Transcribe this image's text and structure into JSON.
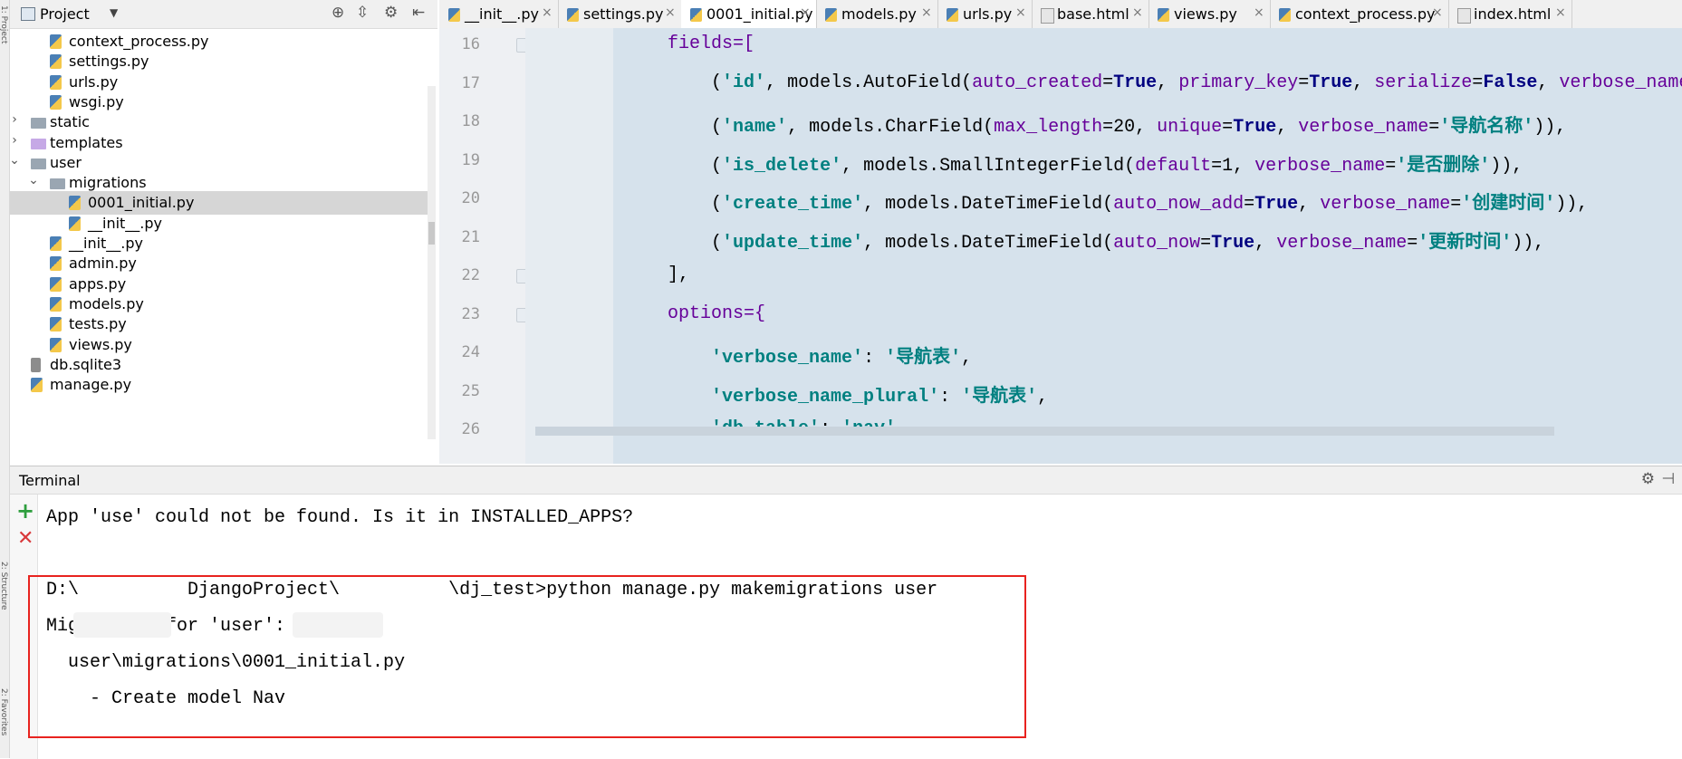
{
  "left_strip": {
    "labels": [
      "1: Project",
      "2: Structure",
      "2: Favorites"
    ]
  },
  "project": {
    "title": "Project",
    "items": [
      {
        "label": "context_process.py",
        "type": "py",
        "depth": 3
      },
      {
        "label": "settings.py",
        "type": "py",
        "depth": 3
      },
      {
        "label": "urls.py",
        "type": "py",
        "depth": 3
      },
      {
        "label": "wsgi.py",
        "type": "py",
        "depth": 3
      },
      {
        "label": "static",
        "type": "folder",
        "depth": 2,
        "arrow": "›"
      },
      {
        "label": "templates",
        "type": "folder-purple",
        "depth": 2,
        "arrow": "›"
      },
      {
        "label": "user",
        "type": "folder",
        "depth": 2,
        "arrow": "⌄"
      },
      {
        "label": "migrations",
        "type": "folder",
        "depth": 3,
        "arrow": "⌄"
      },
      {
        "label": "0001_initial.py",
        "type": "py",
        "depth": 4,
        "selected": true
      },
      {
        "label": "__init__.py",
        "type": "py",
        "depth": 4
      },
      {
        "label": "__init__.py",
        "type": "py",
        "depth": 3
      },
      {
        "label": "admin.py",
        "type": "py",
        "depth": 3
      },
      {
        "label": "apps.py",
        "type": "py",
        "depth": 3
      },
      {
        "label": "models.py",
        "type": "py",
        "depth": 3
      },
      {
        "label": "tests.py",
        "type": "py",
        "depth": 3
      },
      {
        "label": "views.py",
        "type": "py",
        "depth": 3
      },
      {
        "label": "db.sqlite3",
        "type": "db",
        "depth": 2
      },
      {
        "label": "manage.py",
        "type": "py",
        "depth": 2
      }
    ]
  },
  "tabs": [
    {
      "label": "__init__.py",
      "type": "py"
    },
    {
      "label": "settings.py",
      "type": "py"
    },
    {
      "label": "0001_initial.py",
      "type": "py",
      "active": true
    },
    {
      "label": "models.py",
      "type": "py"
    },
    {
      "label": "urls.py",
      "type": "py"
    },
    {
      "label": "base.html",
      "type": "html"
    },
    {
      "label": "views.py",
      "type": "py"
    },
    {
      "label": "context_process.py",
      "type": "py"
    },
    {
      "label": "index.html",
      "type": "html"
    }
  ],
  "tab_close_glyph": "×",
  "editor": {
    "line_numbers": [
      "16",
      "17",
      "18",
      "19",
      "20",
      "21",
      "22",
      "23",
      "24",
      "25",
      "26"
    ],
    "lines": [
      [
        {
          "t": "            fields=[",
          "c": "c-arg"
        }
      ],
      [
        {
          "t": "                (",
          "c": ""
        },
        {
          "t": "'id'",
          "c": "c-str"
        },
        {
          "t": ", models.AutoField(",
          "c": ""
        },
        {
          "t": "auto_created",
          "c": "c-arg"
        },
        {
          "t": "=",
          "c": ""
        },
        {
          "t": "True",
          "c": "c-kw"
        },
        {
          "t": ", ",
          "c": ""
        },
        {
          "t": "primary_key",
          "c": "c-arg"
        },
        {
          "t": "=",
          "c": ""
        },
        {
          "t": "True",
          "c": "c-kw"
        },
        {
          "t": ", ",
          "c": ""
        },
        {
          "t": "serialize",
          "c": "c-arg"
        },
        {
          "t": "=",
          "c": ""
        },
        {
          "t": "False",
          "c": "c-kw"
        },
        {
          "t": ", ",
          "c": ""
        },
        {
          "t": "verbose_name",
          "c": "c-arg"
        }
      ],
      [
        {
          "t": "                (",
          "c": ""
        },
        {
          "t": "'name'",
          "c": "c-str"
        },
        {
          "t": ", models.CharField(",
          "c": ""
        },
        {
          "t": "max_length",
          "c": "c-arg"
        },
        {
          "t": "=20, ",
          "c": ""
        },
        {
          "t": "unique",
          "c": "c-arg"
        },
        {
          "t": "=",
          "c": ""
        },
        {
          "t": "True",
          "c": "c-kw"
        },
        {
          "t": ", ",
          "c": ""
        },
        {
          "t": "verbose_name",
          "c": "c-arg"
        },
        {
          "t": "=",
          "c": ""
        },
        {
          "t": "'导航名称'",
          "c": "c-str"
        },
        {
          "t": ")),",
          "c": ""
        }
      ],
      [
        {
          "t": "                (",
          "c": ""
        },
        {
          "t": "'is_delete'",
          "c": "c-str"
        },
        {
          "t": ", models.SmallIntegerField(",
          "c": ""
        },
        {
          "t": "default",
          "c": "c-arg"
        },
        {
          "t": "=1, ",
          "c": ""
        },
        {
          "t": "verbose_name",
          "c": "c-arg"
        },
        {
          "t": "=",
          "c": ""
        },
        {
          "t": "'是否删除'",
          "c": "c-str"
        },
        {
          "t": ")),",
          "c": ""
        }
      ],
      [
        {
          "t": "                (",
          "c": ""
        },
        {
          "t": "'create_time'",
          "c": "c-str"
        },
        {
          "t": ", models.DateTimeField(",
          "c": ""
        },
        {
          "t": "auto_now_add",
          "c": "c-arg"
        },
        {
          "t": "=",
          "c": ""
        },
        {
          "t": "True",
          "c": "c-kw"
        },
        {
          "t": ", ",
          "c": ""
        },
        {
          "t": "verbose_name",
          "c": "c-arg"
        },
        {
          "t": "=",
          "c": ""
        },
        {
          "t": "'创建时间'",
          "c": "c-str"
        },
        {
          "t": ")),",
          "c": ""
        }
      ],
      [
        {
          "t": "                (",
          "c": ""
        },
        {
          "t": "'update_time'",
          "c": "c-str"
        },
        {
          "t": ", models.DateTimeField(",
          "c": ""
        },
        {
          "t": "auto_now",
          "c": "c-arg"
        },
        {
          "t": "=",
          "c": ""
        },
        {
          "t": "True",
          "c": "c-kw"
        },
        {
          "t": ", ",
          "c": ""
        },
        {
          "t": "verbose_name",
          "c": "c-arg"
        },
        {
          "t": "=",
          "c": ""
        },
        {
          "t": "'更新时间'",
          "c": "c-str"
        },
        {
          "t": ")),",
          "c": ""
        }
      ],
      [
        {
          "t": "            ],",
          "c": ""
        }
      ],
      [
        {
          "t": "            options={",
          "c": "c-arg"
        }
      ],
      [
        {
          "t": "                ",
          "c": ""
        },
        {
          "t": "'verbose_name'",
          "c": "c-str"
        },
        {
          "t": ": ",
          "c": ""
        },
        {
          "t": "'导航表'",
          "c": "c-str"
        },
        {
          "t": ",",
          "c": ""
        }
      ],
      [
        {
          "t": "                ",
          "c": ""
        },
        {
          "t": "'verbose_name_plural'",
          "c": "c-str"
        },
        {
          "t": ": ",
          "c": ""
        },
        {
          "t": "'导航表'",
          "c": "c-str"
        },
        {
          "t": ",",
          "c": ""
        }
      ],
      [
        {
          "t": "                ",
          "c": ""
        },
        {
          "t": "'db_table'",
          "c": "c-str"
        },
        {
          "t": ": ",
          "c": ""
        },
        {
          "t": "'nav'",
          "c": "c-str"
        }
      ]
    ]
  },
  "terminal": {
    "title": "Terminal",
    "lines": [
      "App 'use' could not be found. Is it in INSTALLED_APPS?",
      "",
      "D:\\          DjangoProject\\          \\dj_test>python manage.py makemigrations user",
      "Migrations for 'user':",
      "  user\\migrations\\0001_initial.py",
      "    - Create model Nav"
    ]
  },
  "colors": {
    "editor_bg": "#d6e2ec",
    "highlight_box": "#e8231f",
    "string": "#008080",
    "keyword": "#000080",
    "argument": "#660099"
  }
}
